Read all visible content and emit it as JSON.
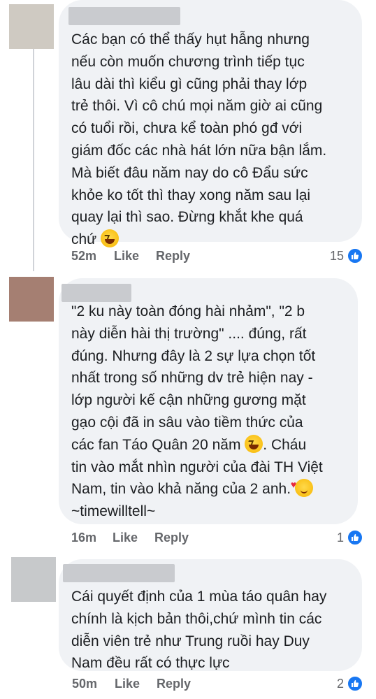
{
  "colors": {
    "bubble": "#f0f2f5",
    "meta_text": "#65676b",
    "like_blue": "#1877f2",
    "avatar_1": "#cfcac2",
    "avatar_2": "#a57f72",
    "avatar_3": "#c7c9cb"
  },
  "actions": {
    "like": "Like",
    "reply": "Reply"
  },
  "comments": [
    {
      "lines": [
        "Các bạn có thể thấy hụt hẫng nhưng",
        "nếu còn muốn chương trình tiếp tục",
        "lâu dài thì kiểu gì cũng phải thay lớp",
        "trẻ thôi. Vì cô chú mọi năm giờ ai cũng",
        "có tuổi rồi, chưa kể toàn phó gđ với",
        "giám đốc các nhà hát lớn nữa bận lắm.",
        "Mà biết đâu năm nay do cô Đẩu sức",
        "khỏe ko tốt thì thay xong năm sau lại",
        "quay lại thì sao. Đừng khắt khe quá",
        "chứ"
      ],
      "emoji_after_last": "grinning-squinting-face-icon",
      "time": "52m",
      "reactions": "15"
    },
    {
      "lines": [
        "\"2 ku này toàn đóng hài nhảm\", \"2 b",
        "này diễn hài thị trường\" .... đúng, rất",
        "đúng. Nhưng đây là 2 sự lựa chọn tốt",
        "nhất trong số những dv trẻ hiện nay -",
        "lớp người kế cận những gương mặt",
        "gạo cội đã in sâu vào tiềm thức của",
        "các fan Táo Quân 20 năm",
        ".  Cháu",
        "tin vào mắt nhìn người của đài TH Việt",
        "Nam, tin vào khả năng của 2 anh.",
        "~timewilltell~"
      ],
      "time": "16m",
      "reactions": "1"
    },
    {
      "lines": [
        "Cái quyết định của 1 mùa táo quân hay",
        "chính là kịch bản thôi,chứ mình tin các",
        "diễn viên trẻ như Trung ruồi hay Duy",
        "Nam đều rất có thực lực"
      ],
      "time": "50m",
      "reactions": "2"
    }
  ]
}
